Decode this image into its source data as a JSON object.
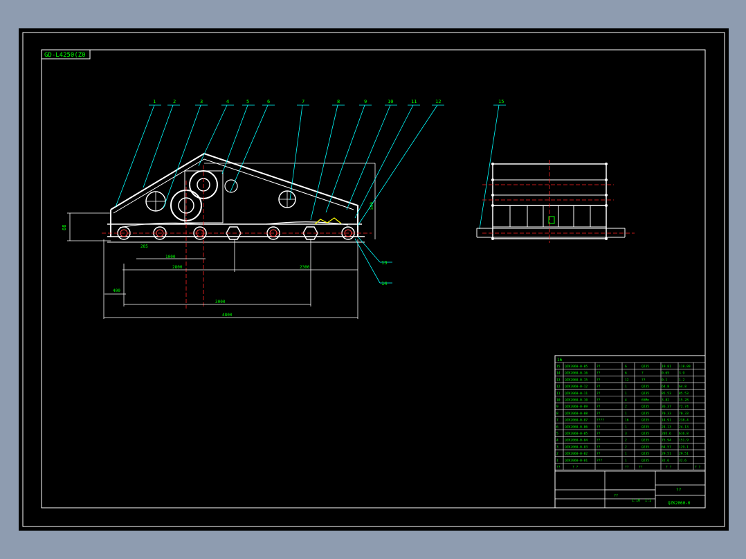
{
  "drawing": {
    "title_tag": "GD-L4250(Z0",
    "part_no": "QZK2060-0",
    "main_title": "??"
  },
  "balloons": [
    "1",
    "2",
    "3",
    "4",
    "5",
    "6",
    "7",
    "8",
    "9",
    "10",
    "11",
    "12",
    "13",
    "14",
    "15"
  ],
  "dimensions": {
    "height_left": "88",
    "a": "285",
    "b": "1000",
    "c": "2800",
    "d": "2300",
    "e": "400",
    "f": "3000",
    "g": "4800",
    "h": "590"
  },
  "bom": {
    "top_index": "16",
    "rows": [
      {
        "no": "15",
        "code": "QZK2060-0-05",
        "name": "??",
        "qty": "6",
        "mat": "Q235",
        "w1": "19.81",
        "w2": "118.89"
      },
      {
        "no": "14",
        "code": "QZK2060-0-16",
        "name": "??",
        "qty": "6",
        "mat": "?",
        "w1": "0.65",
        "w2": "3.9"
      },
      {
        "no": "13",
        "code": "QZK2060-0-15",
        "name": "??",
        "qty": "12",
        "mat": "??",
        "w1": "0.1",
        "w2": "1.2"
      },
      {
        "no": "12",
        "code": "QZK2060-0-12",
        "name": "??",
        "qty": "1",
        "mat": "Q235",
        "w1": "64.8",
        "w2": "64.8"
      },
      {
        "no": "11",
        "code": "QZK2060-0-11",
        "name": "??",
        "qty": "1",
        "mat": "Q235",
        "w1": "85.53",
        "w2": "85.53"
      },
      {
        "no": "10",
        "code": "QZK2060-0-10",
        "name": "??",
        "qty": "4",
        "mat": "65Mn",
        "w1": "3.82",
        "w2": "15.28"
      },
      {
        "no": "9",
        "code": "QZK2060-0-09",
        "name": "??",
        "qty": "2",
        "mat": "Q235",
        "w1": "36.37",
        "w2": "72.74"
      },
      {
        "no": "8",
        "code": "QZK2060-0-08",
        "name": "??",
        "qty": "1",
        "mat": "Q235",
        "w1": "70.33",
        "w2": "70.33"
      },
      {
        "no": "7",
        "code": "QZK2060-0-07",
        "name": "????",
        "qty": "16",
        "mat": "Q235",
        "w1": "14.91",
        "w2": "238.4"
      },
      {
        "no": "6",
        "code": "QZK2060-0-06",
        "name": "??",
        "qty": "1",
        "mat": "Q235",
        "w1": "24.13",
        "w2": "24.13"
      },
      {
        "no": "5",
        "code": "QZK2060-0-05",
        "name": "??",
        "qty": "3",
        "mat": "Q235",
        "w1": "205.6",
        "w2": "616.8"
      },
      {
        "no": "4",
        "code": "QZK2060-0-04",
        "name": "??",
        "qty": "2",
        "mat": "Q235",
        "w1": "75.94",
        "w2": "151.9"
      },
      {
        "no": "3",
        "code": "QZK2060-0-03",
        "name": "??",
        "qty": "2",
        "mat": "Q235",
        "w1": "64.57",
        "w2": "129.1"
      },
      {
        "no": "2",
        "code": "QZK2060-0-02",
        "name": "??",
        "qty": "1",
        "mat": "Q235",
        "w1": "29.51",
        "w2": "29.51"
      },
      {
        "no": "1",
        "code": "QZK2060-0-01",
        "name": "???",
        "qty": "1",
        "mat": "Q235",
        "w1": "32.6",
        "w2": "32.6"
      }
    ],
    "header": {
      "no": "??",
      "name": "?  ?",
      "qty": "??",
      "mat": "??",
      "w": "?  ?",
      "note": "?  ?"
    }
  },
  "title_block": {
    "ratio": "1:10",
    "sheet": "??",
    "scale": "1:1"
  },
  "colors": {
    "background": "#000000",
    "border": "#ffffff",
    "leader": "#00ffff",
    "text": "#00ff00",
    "center": "#ff0000",
    "part": "#ffffff"
  }
}
